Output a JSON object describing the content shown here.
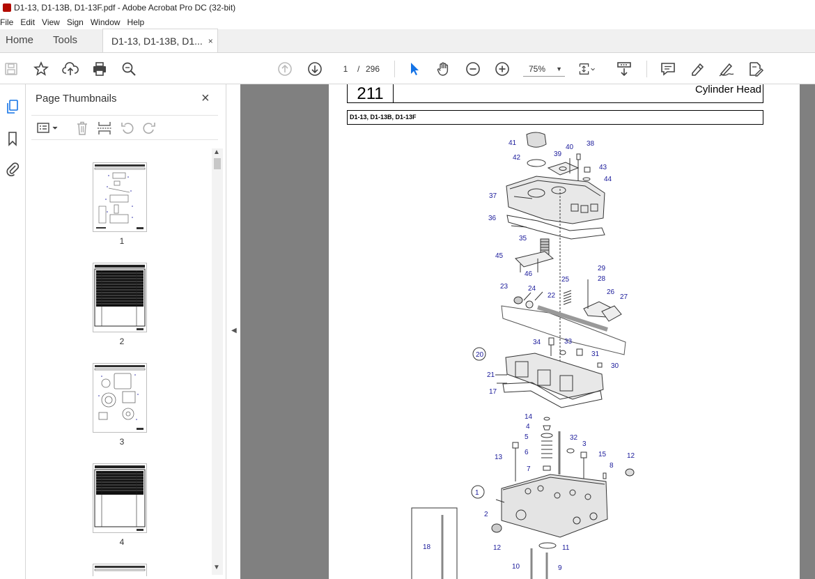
{
  "window": {
    "title": "D1-13, D1-13B, D1-13F.pdf - Adobe Acrobat Pro DC (32-bit)"
  },
  "menu": [
    "File",
    "Edit",
    "View",
    "Sign",
    "Window",
    "Help"
  ],
  "tabs": {
    "home": "Home",
    "tools": "Tools",
    "document": "D1-13, D1-13B, D1...",
    "close": "×"
  },
  "toolbar": {
    "current_page": "1",
    "separator": "/",
    "total_pages": "296",
    "zoom": "75%",
    "icons": [
      "save-icon",
      "bookmark-star-icon",
      "upload-cloud-icon",
      "print-icon",
      "search-zoom-icon",
      "page-up-icon",
      "page-down-icon",
      "select-arrow-icon",
      "hand-icon",
      "zoom-out-icon",
      "zoom-in-icon",
      "page-fit-icon",
      "scroll-mode-icon",
      "comment-icon",
      "highlight-icon",
      "sign-icon",
      "edit-pdf-icon"
    ]
  },
  "panel": {
    "title": "Page Thumbnails",
    "close": "×",
    "thumbnails": [
      {
        "label": "1"
      },
      {
        "label": "2"
      },
      {
        "label": "3"
      },
      {
        "label": "4"
      }
    ]
  },
  "page": {
    "section_number": "211",
    "section_title": "Cylinder Head",
    "models": "D1-13, D1-13B, D1-13F",
    "callouts": [
      "41",
      "42",
      "39",
      "40",
      "38",
      "43",
      "44",
      "37",
      "36",
      "35",
      "45",
      "46",
      "29",
      "28",
      "25",
      "23",
      "24",
      "22",
      "26",
      "27",
      "34",
      "33",
      "31",
      "30",
      "20",
      "21",
      "17",
      "14",
      "4",
      "5",
      "32",
      "3",
      "6",
      "13",
      "15",
      "12",
      "8",
      "7",
      "1",
      "2",
      "12",
      "11",
      "18",
      "10",
      "9"
    ]
  },
  "colors": {
    "accent_blue": "#1473e6",
    "callout_blue": "#1a1a9a",
    "doc_background": "#808080"
  }
}
